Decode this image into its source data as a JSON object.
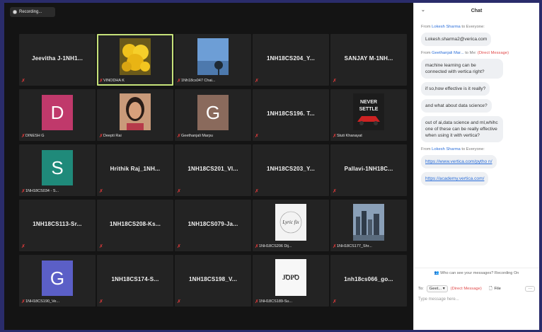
{
  "recording": {
    "label": "Recording..."
  },
  "participants": [
    {
      "label": "Jeevitha J-1NH1...",
      "kind": "name",
      "active": false
    },
    {
      "label": "VINODHA K",
      "kind": "image",
      "active": true,
      "image": "yellow-flowers-photo"
    },
    {
      "label": "1Nh18cs047 Chai...",
      "kind": "image",
      "active": false,
      "image": "sky-tree-photo"
    },
    {
      "label": "1NH18CS204_Y...",
      "kind": "name",
      "active": false
    },
    {
      "label": "SANJAY M-1NH...",
      "kind": "name",
      "active": false
    },
    {
      "label": "DINESH G",
      "kind": "avatar",
      "letter": "D",
      "color": "#c0396b",
      "active": false
    },
    {
      "label": "Deepti Rai",
      "kind": "image",
      "active": false,
      "image": "woman-portrait-photo"
    },
    {
      "label": "Geethanjali Marpu",
      "kind": "avatar",
      "letter": "G",
      "color": "#8a6a5c",
      "active": false
    },
    {
      "label": "1NH18CS196. T...",
      "kind": "name",
      "active": false
    },
    {
      "label": "Stuti Khanayat",
      "kind": "image",
      "active": false,
      "image": "never-settle-car-photo",
      "overlay": "NEVER SETTLE"
    },
    {
      "label": "1NH18CS034 - S...",
      "kind": "avatar",
      "letter": "S",
      "color": "#1f8a7a",
      "active": false
    },
    {
      "label": "Hrithik Raj_1NH...",
      "kind": "name",
      "active": false
    },
    {
      "label": "1NH18CS201_VI...",
      "kind": "name",
      "active": false
    },
    {
      "label": "1NH18CS203_Y...",
      "kind": "name",
      "active": false
    },
    {
      "label": "Pallavi-1NH18C...",
      "kind": "name",
      "active": false
    },
    {
      "label": "1NH18CS113-Sr...",
      "kind": "name",
      "active": false
    },
    {
      "label": "1NH18CS208-Ks...",
      "kind": "name",
      "active": false
    },
    {
      "label": "1NH18CS079-Ja...",
      "kind": "name",
      "active": false
    },
    {
      "label": "1NH18CS206 Dij...",
      "kind": "image",
      "active": false,
      "image": "lyric-logo-photo",
      "overlay": "Lyric fix"
    },
    {
      "label": "1NH18CS177_Shr...",
      "kind": "image",
      "active": false,
      "image": "city-skyline-photo"
    },
    {
      "label": "1NH18CS190_Ve...",
      "kind": "avatar",
      "letter": "G",
      "color": "#5b5fc7",
      "active": false
    },
    {
      "label": "1NH18CS174-S...",
      "kind": "name",
      "active": false
    },
    {
      "label": "1NH18CS198_V...",
      "kind": "name",
      "active": false
    },
    {
      "label": "1NH18CS189-Su...",
      "kind": "image",
      "active": false,
      "image": "jdpd-logo-photo",
      "overlay": "JꝹPꝹ"
    },
    {
      "label": "1nh18cs066_go...",
      "kind": "name",
      "active": false
    }
  ],
  "chat": {
    "title": "Chat",
    "messages": [
      {
        "from": "From",
        "sender": "Lokesh Sharma",
        "to": "to Everyone:",
        "dm": "",
        "texts": [
          "Lokesh.sharma2@verica.com"
        ],
        "links": []
      },
      {
        "from": "From",
        "sender": "Geethanjali Mar...",
        "to": "to Me:",
        "dm": "(Direct Message)",
        "texts": [
          "machine learning can be connected with vertica right?",
          "if so,how effective is it really?",
          "and what about data science?",
          "out of ai,data science and ml,whihc one of these can be really effective when using it with vertica?"
        ],
        "links": []
      },
      {
        "from": "From",
        "sender": "Lokesh Sharma",
        "to": "to Everyone:",
        "dm": "",
        "texts": [],
        "links": [
          "https://www.vertica.com/pytho n/",
          "https://academy.vertica.com/"
        ]
      }
    ],
    "who_can_see": "Who can see your messages? Recording On",
    "to_label": "To:",
    "to_value": "Geet...",
    "to_dm": "(Direct Message)",
    "file_label": "File",
    "more_label": "···",
    "placeholder": "Type message here..."
  }
}
